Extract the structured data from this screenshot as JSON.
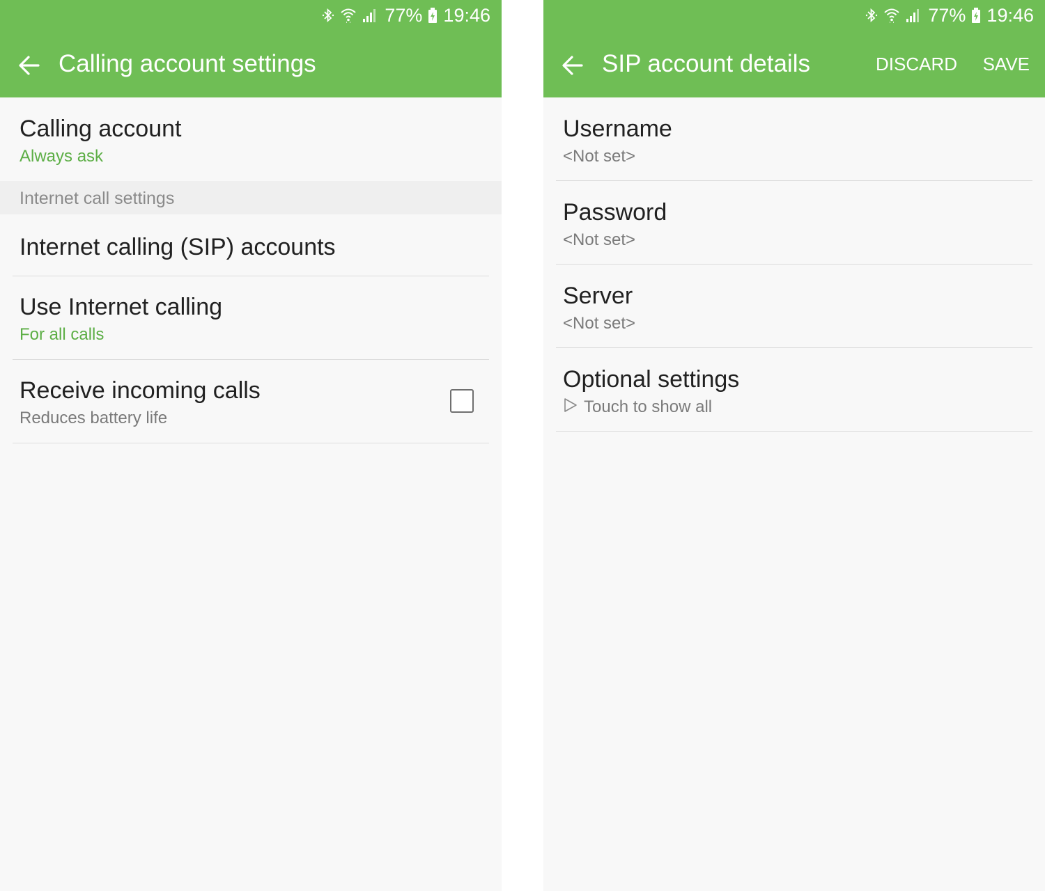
{
  "colors": {
    "appbar": "#6fbe55",
    "accent": "#5cae45",
    "background": "#f8f8f8"
  },
  "status": {
    "battery": "77%",
    "time": "19:46",
    "icons": [
      "bluetooth-icon",
      "wifi-icon",
      "signal-icon",
      "battery-charging-icon"
    ]
  },
  "left": {
    "title": "Calling account settings",
    "calling_account": {
      "title": "Calling account",
      "summary": "Always ask"
    },
    "section_header": "Internet call settings",
    "sip_accounts": {
      "title": "Internet calling (SIP) accounts"
    },
    "use_internet_calling": {
      "title": "Use Internet calling",
      "summary": "For all calls"
    },
    "receive_incoming": {
      "title": "Receive incoming calls",
      "summary": "Reduces battery life",
      "checked": false
    }
  },
  "right": {
    "title": "SIP account details",
    "discard_label": "DISCARD",
    "save_label": "SAVE",
    "username": {
      "title": "Username",
      "value": "<Not set>"
    },
    "password": {
      "title": "Password",
      "value": "<Not set>"
    },
    "server": {
      "title": "Server",
      "value": "<Not set>"
    },
    "optional": {
      "title": "Optional settings",
      "hint": "Touch to show all"
    }
  }
}
